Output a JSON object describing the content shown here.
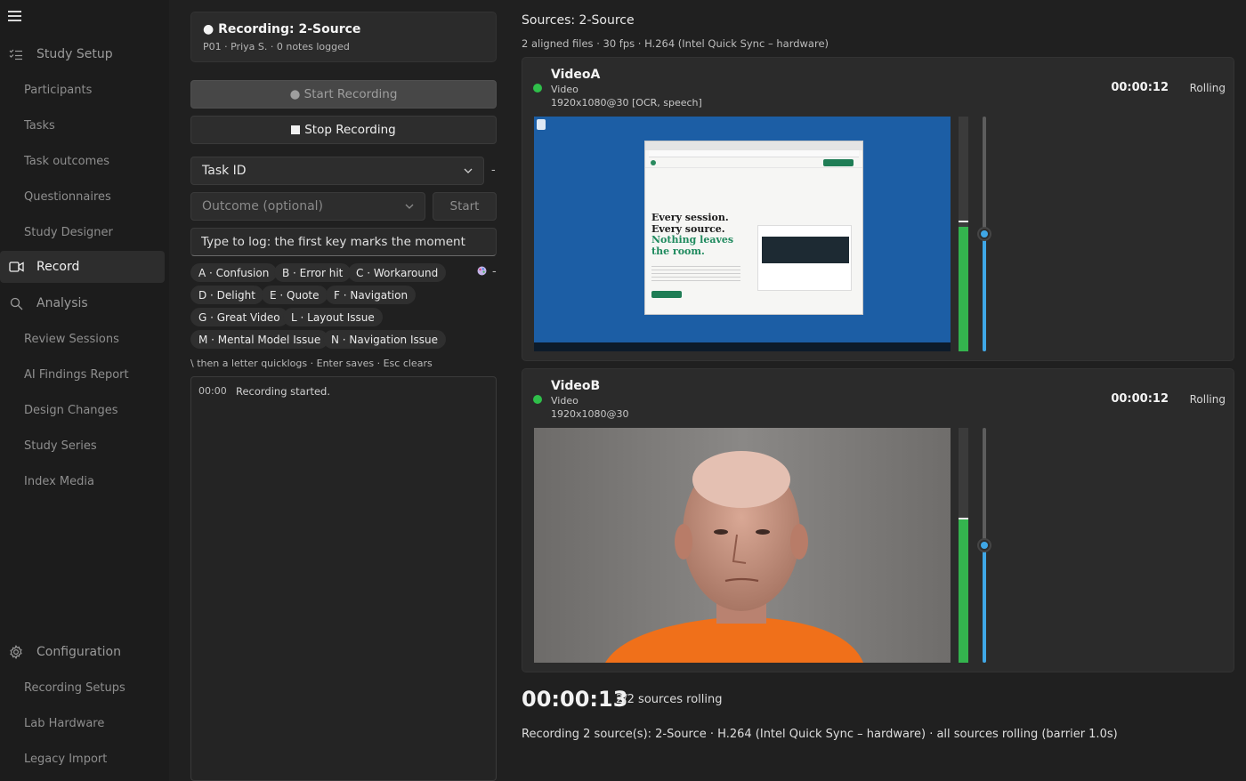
{
  "sidebar": {
    "menu_icon": "hamburger-icon",
    "groups": [
      {
        "label": "Study Setup",
        "icon": "list-icon"
      },
      {
        "label": "Analysis",
        "icon": "search-icon"
      },
      {
        "label": "Configuration",
        "icon": "gear-icon"
      }
    ],
    "items": [
      "Participants",
      "Tasks",
      "Task outcomes",
      "Questionnaires",
      "Study Designer",
      "Record",
      "Review Sessions",
      "AI Findings Report",
      "Design Changes",
      "Study Series",
      "Index Media",
      "Recording Setups",
      "Lab Hardware",
      "Legacy Import"
    ],
    "active": "Record"
  },
  "recording": {
    "title": "● Recording:  2-Source",
    "subtitle": "P01 · Priya S. · 0 notes logged"
  },
  "controls": {
    "start_label": "● Start Recording",
    "stop_label": "Stop Recording",
    "task_select": "Task ID",
    "outcome_select": "Outcome (optional)",
    "task_start_label": "Start",
    "dash": "-",
    "log_placeholder": "Type to log: the first key marks the moment",
    "hint": "\\ then a letter quicklogs · Enter saves · Esc clears"
  },
  "quicklogs": [
    "A · Confusion",
    "B · Error hit",
    "C · Workaround",
    "D · Delight",
    "E · Quote",
    "F · Navigation",
    "G · Great Video",
    "L · Layout Issue",
    "M · Mental Model Issue",
    "N · Navigation Issue"
  ],
  "log": [
    {
      "time": "00:00",
      "text": "Recording started."
    }
  ],
  "sources": {
    "title": "Sources: 2-Source",
    "subtitle": "2 aligned files · 30 fps · H.264 (Intel Quick Sync – hardware)",
    "items": [
      {
        "name": "VideoA",
        "kind": "Video",
        "resolution": "1920x1080@30  [OCR, speech]",
        "time": "00:00:12",
        "state": "Rolling",
        "status_color": "#2fbf4a",
        "meter_level": 0.53,
        "peak_level": 0.55,
        "volume": 0.5
      },
      {
        "name": "VideoB",
        "kind": "Video",
        "resolution": "1920x1080@30",
        "time": "00:00:12",
        "state": "Rolling",
        "status_color": "#2fbf4a",
        "meter_level": 0.61,
        "peak_level": 0.61,
        "volume": 0.5
      }
    ]
  },
  "screen_preview": {
    "headline": [
      "Every session.",
      "Every source."
    ],
    "headline_accent": [
      "Nothing leaves",
      "the room."
    ]
  },
  "summary": {
    "clock": "00:00:13",
    "clock_status": "2/2 sources rolling",
    "status_line": "Recording 2 source(s): 2-Source · H.264 (Intel Quick Sync – hardware) · all sources rolling (barrier 1.0s)"
  }
}
